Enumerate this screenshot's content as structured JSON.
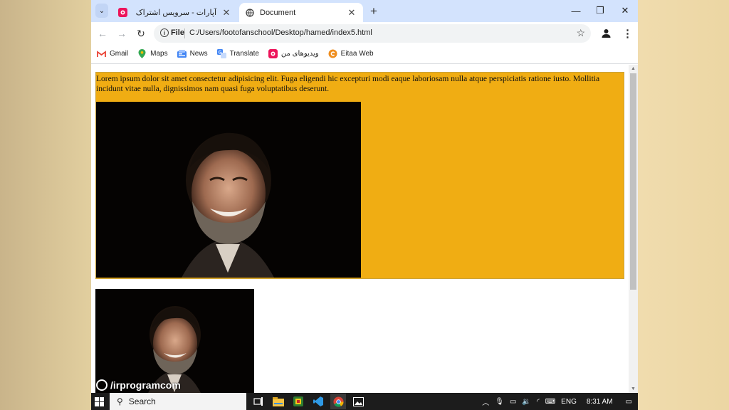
{
  "browser": {
    "tabs": [
      {
        "title": "آپارات - سرویس اشتراک ویدیو",
        "active": false
      },
      {
        "title": "Document",
        "active": true
      }
    ],
    "address": {
      "scheme_label": "File",
      "url": "C:/Users/footofanschool/Desktop/hamed/index5.html"
    },
    "bookmarks": [
      {
        "label": "Gmail",
        "icon": "gmail-icon"
      },
      {
        "label": "Maps",
        "icon": "maps-icon"
      },
      {
        "label": "News",
        "icon": "news-icon"
      },
      {
        "label": "Translate",
        "icon": "translate-icon"
      },
      {
        "label": "ویدیوهای من",
        "icon": "aparat-icon"
      },
      {
        "label": "Eitaa Web",
        "icon": "eitaa-icon"
      }
    ]
  },
  "page": {
    "paragraph": "Lorem ipsum dolor sit amet consectetur adipisicing elit. Fuga eligendi hic excepturi modi eaque laboriosam nulla atque perspiciatis ratione iusto. Mollitia incidunt vitae nulla, dignissimos nam quasi fuga voluptatibus deserunt.",
    "highlight_color": "#f0ad13"
  },
  "watermark": "/irprogramcom",
  "taskbar": {
    "search_label": "Search",
    "language": "ENG",
    "time": "8:31 AM"
  }
}
